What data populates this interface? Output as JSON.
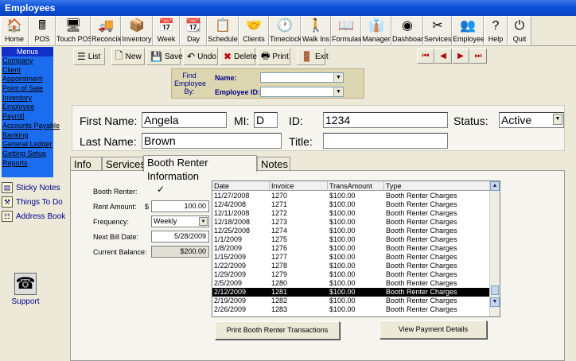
{
  "window": {
    "title": "Employees"
  },
  "toolbar": {
    "items": [
      {
        "label": "Home",
        "icon": "home-icon",
        "glyph": "🏠"
      },
      {
        "label": "POS",
        "icon": "cash-register-icon",
        "glyph": "🖩"
      },
      {
        "label": "Touch POS",
        "icon": "touch-pos-icon",
        "glyph": "🖥"
      },
      {
        "label": "Reconcile",
        "icon": "reconcile-icon",
        "glyph": "🚚"
      },
      {
        "label": "Inventory",
        "icon": "inventory-icon",
        "glyph": "📦"
      },
      {
        "label": "Week",
        "icon": "calendar-week-icon",
        "glyph": "📅"
      },
      {
        "label": "Day",
        "icon": "calendar-day-icon",
        "glyph": "📆"
      },
      {
        "label": "Schedule",
        "icon": "schedule-icon",
        "glyph": "📋"
      },
      {
        "label": "Clients",
        "icon": "handshake-icon",
        "glyph": "🤝"
      },
      {
        "label": "Timeclock",
        "icon": "clock-icon",
        "glyph": "🕐"
      },
      {
        "label": "Walk Ins",
        "icon": "walk-ins-icon",
        "glyph": "🚶"
      },
      {
        "label": "Formulas",
        "icon": "formulas-icon",
        "glyph": "📖"
      },
      {
        "label": "Manager",
        "icon": "manager-icon",
        "glyph": "👔"
      },
      {
        "label": "Dashboard",
        "icon": "dashboard-icon",
        "glyph": "◉"
      },
      {
        "label": "Services",
        "icon": "scissors-icon",
        "glyph": "✂"
      },
      {
        "label": "Employees",
        "icon": "employees-icon",
        "glyph": "👥"
      },
      {
        "label": "Help",
        "icon": "help-icon",
        "glyph": "?"
      },
      {
        "label": "Quit",
        "icon": "quit-icon",
        "glyph": "⏻"
      }
    ]
  },
  "sidebar": {
    "header": "Menus",
    "items": [
      "Company",
      "Client",
      "Appointment",
      "Point of Sale",
      "Inventory",
      "Employee",
      "Payroll",
      "Accounts Payable",
      "Banking",
      "General Ledger",
      "Getting Setup",
      "Reports"
    ],
    "links": [
      {
        "label": "Sticky Notes",
        "icon": "sticky-note-icon",
        "glyph": "▤"
      },
      {
        "label": "Things To Do",
        "icon": "hammer-icon",
        "glyph": "⚒"
      },
      {
        "label": "Address Book",
        "icon": "address-book-icon",
        "glyph": "☷"
      }
    ],
    "support": {
      "label": "Support",
      "glyph": "☎"
    }
  },
  "actions": {
    "list": "List",
    "new": "New",
    "save": "Save",
    "undo": "Undo",
    "delete": "Delete",
    "print": "Print",
    "exit": "Exit"
  },
  "find": {
    "label": "Find Employee By:",
    "name_label": "Name:",
    "id_label": "Employee ID:",
    "name_value": "",
    "id_value": ""
  },
  "employee": {
    "first_name_label": "First Name:",
    "first_name": "Angela",
    "mi_label": "MI:",
    "mi": "D",
    "id_label": "ID:",
    "id": "1234",
    "status_label": "Status:",
    "status": "Active",
    "last_name_label": "Last Name:",
    "last_name": "Brown",
    "title_label": "Title:",
    "title": ""
  },
  "tabs": [
    "Info",
    "Services",
    "Booth Renter Information",
    "Notes"
  ],
  "booth": {
    "renter_label": "Booth Renter:",
    "renter_checked": "✓",
    "rent_label": "Rent Amount:",
    "rent_currency": "$",
    "rent_value": "100.00",
    "frequency_label": "Frequency:",
    "frequency_value": "Weekly",
    "next_bill_label": "Next Bill Date:",
    "next_bill_value": "5/28/2009",
    "balance_label": "Current Balance:",
    "balance_value": "$200.00"
  },
  "transactions": {
    "columns": [
      "Date",
      "Invoice",
      "TransAmount",
      "Type"
    ],
    "rows": [
      [
        "11/27/2008",
        "1270",
        "$100.00",
        "Booth Renter Charges"
      ],
      [
        "12/4/2008",
        "1271",
        "$100.00",
        "Booth Renter Charges"
      ],
      [
        "12/11/2008",
        "1272",
        "$100.00",
        "Booth Renter Charges"
      ],
      [
        "12/18/2008",
        "1273",
        "$100.00",
        "Booth Renter Charges"
      ],
      [
        "12/25/2008",
        "1274",
        "$100.00",
        "Booth Renter Charges"
      ],
      [
        "1/1/2009",
        "1275",
        "$100.00",
        "Booth Renter Charges"
      ],
      [
        "1/8/2009",
        "1276",
        "$100.00",
        "Booth Renter Charges"
      ],
      [
        "1/15/2009",
        "1277",
        "$100.00",
        "Booth Renter Charges"
      ],
      [
        "1/22/2009",
        "1278",
        "$100.00",
        "Booth Renter Charges"
      ],
      [
        "1/29/2009",
        "1279",
        "$100.00",
        "Booth Renter Charges"
      ],
      [
        "2/5/2009",
        "1280",
        "$100.00",
        "Booth Renter Charges"
      ],
      [
        "2/12/2009",
        "1281",
        "$100.00",
        "Booth Renter Charges"
      ],
      [
        "2/19/2009",
        "1282",
        "$100.00",
        "Booth Renter Charges"
      ],
      [
        "2/26/2009",
        "1283",
        "$100.00",
        "Booth Renter Charges"
      ]
    ],
    "selected_index": 11
  },
  "buttons": {
    "print_transactions": "Print Booth Renter Transactions",
    "view_payment": "View Payment Details"
  },
  "nav": {
    "first": "⏮",
    "prev": "◀",
    "next": "▶",
    "last": "⏭"
  }
}
